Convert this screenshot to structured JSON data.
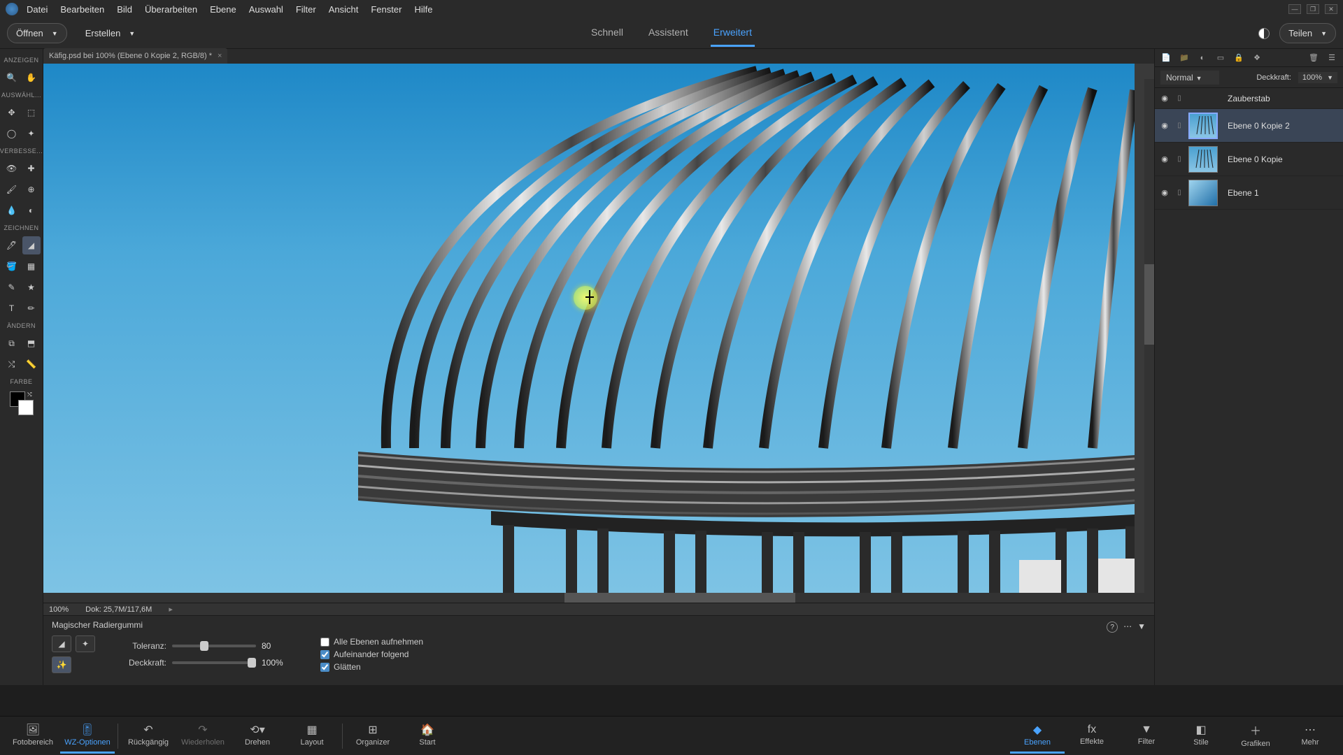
{
  "menubar": [
    "Datei",
    "Bearbeiten",
    "Bild",
    "Überarbeiten",
    "Ebene",
    "Auswahl",
    "Filter",
    "Ansicht",
    "Fenster",
    "Hilfe"
  ],
  "toolbar": {
    "open": "Öffnen",
    "create": "Erstellen",
    "share": "Teilen"
  },
  "modes": {
    "quick": "Schnell",
    "guided": "Assistent",
    "expert": "Erweitert"
  },
  "doc": {
    "title": "Käfig.psd bei 100% (Ebene 0 Kopie 2, RGB/8) *"
  },
  "tool_sections": {
    "view": "ANZEIGEN",
    "select": "AUSWÄHL...",
    "enhance": "VERBESSE...",
    "draw": "ZEICHNEN",
    "modify": "ÄNDERN",
    "color": "FARBE"
  },
  "status": {
    "zoom": "100%",
    "doc": "Dok: 25,7M/117,6M"
  },
  "options": {
    "tool_name": "Magischer Radiergummi",
    "tolerance_label": "Toleranz:",
    "tolerance_value": "80",
    "opacity_label": "Deckkraft:",
    "opacity_value": "100%",
    "all_layers": "Alle Ebenen aufnehmen",
    "contiguous": "Aufeinander folgend",
    "antialias": "Glätten"
  },
  "layers_panel": {
    "blend_mode": "Normal",
    "opacity_label": "Deckkraft:",
    "opacity_value": "100%",
    "layers": [
      {
        "name": "Zauberstab"
      },
      {
        "name": "Ebene 0 Kopie 2"
      },
      {
        "name": "Ebene 0 Kopie"
      },
      {
        "name": "Ebene 1"
      }
    ]
  },
  "bottom_nav": {
    "left": [
      "Fotobereich",
      "WZ-Optionen",
      "Rückgängig",
      "Wiederholen",
      "Drehen",
      "Layout",
      "Organizer",
      "Start"
    ],
    "right": [
      "Ebenen",
      "Effekte",
      "Filter",
      "Stile",
      "Grafiken",
      "Mehr"
    ]
  }
}
